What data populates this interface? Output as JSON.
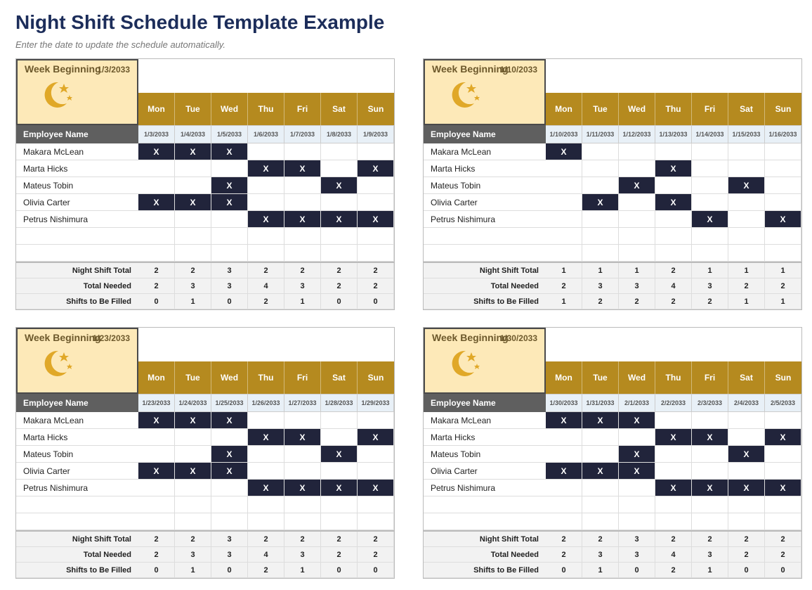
{
  "title": "Night Shift Schedule Template Example",
  "subtitle": "Enter the date to update the schedule automatically.",
  "labels": {
    "week_beginning": "Week Beginning",
    "employee_name": "Employee Name",
    "days": [
      "Mon",
      "Tue",
      "Wed",
      "Thu",
      "Fri",
      "Sat",
      "Sun"
    ],
    "totals": [
      "Night Shift Total",
      "Total Needed",
      "Shifts to Be Filled"
    ]
  },
  "employees": [
    "Makara McLean",
    "Marta Hicks",
    "Mateus Tobin",
    "Olivia Carter",
    "Petrus Nishimura"
  ],
  "blocks": [
    {
      "week_date": "1/3/2033",
      "dates": [
        "1/3/2033",
        "1/4/2033",
        "1/5/2033",
        "1/6/2033",
        "1/7/2033",
        "1/8/2033",
        "1/9/2033"
      ],
      "shifts": [
        [
          1,
          1,
          1,
          0,
          0,
          0,
          0
        ],
        [
          0,
          0,
          0,
          1,
          1,
          0,
          1
        ],
        [
          0,
          0,
          1,
          0,
          0,
          1,
          0
        ],
        [
          1,
          1,
          1,
          0,
          0,
          0,
          0
        ],
        [
          0,
          0,
          0,
          1,
          1,
          1,
          1
        ]
      ],
      "totals": [
        [
          2,
          2,
          3,
          2,
          2,
          2,
          2
        ],
        [
          2,
          3,
          3,
          4,
          3,
          2,
          2
        ],
        [
          0,
          1,
          0,
          2,
          1,
          0,
          0
        ]
      ]
    },
    {
      "week_date": "1/10/2033",
      "dates": [
        "1/10/2033",
        "1/11/2033",
        "1/12/2033",
        "1/13/2033",
        "1/14/2033",
        "1/15/2033",
        "1/16/2033"
      ],
      "shifts": [
        [
          1,
          0,
          0,
          0,
          0,
          0,
          0
        ],
        [
          0,
          0,
          0,
          1,
          0,
          0,
          0
        ],
        [
          0,
          0,
          1,
          0,
          0,
          1,
          0
        ],
        [
          0,
          1,
          0,
          1,
          0,
          0,
          0
        ],
        [
          0,
          0,
          0,
          0,
          1,
          0,
          1
        ]
      ],
      "totals": [
        [
          1,
          1,
          1,
          2,
          1,
          1,
          1
        ],
        [
          2,
          3,
          3,
          4,
          3,
          2,
          2
        ],
        [
          1,
          2,
          2,
          2,
          2,
          1,
          1
        ]
      ]
    },
    {
      "week_date": "1/23/2033",
      "dates": [
        "1/23/2033",
        "1/24/2033",
        "1/25/2033",
        "1/26/2033",
        "1/27/2033",
        "1/28/2033",
        "1/29/2033"
      ],
      "shifts": [
        [
          1,
          1,
          1,
          0,
          0,
          0,
          0
        ],
        [
          0,
          0,
          0,
          1,
          1,
          0,
          1
        ],
        [
          0,
          0,
          1,
          0,
          0,
          1,
          0
        ],
        [
          1,
          1,
          1,
          0,
          0,
          0,
          0
        ],
        [
          0,
          0,
          0,
          1,
          1,
          1,
          1
        ]
      ],
      "totals": [
        [
          2,
          2,
          3,
          2,
          2,
          2,
          2
        ],
        [
          2,
          3,
          3,
          4,
          3,
          2,
          2
        ],
        [
          0,
          1,
          0,
          2,
          1,
          0,
          0
        ]
      ]
    },
    {
      "week_date": "1/30/2033",
      "dates": [
        "1/30/2033",
        "1/31/2033",
        "2/1/2033",
        "2/2/2033",
        "2/3/2033",
        "2/4/2033",
        "2/5/2033"
      ],
      "shifts": [
        [
          1,
          1,
          1,
          0,
          0,
          0,
          0
        ],
        [
          0,
          0,
          0,
          1,
          1,
          0,
          1
        ],
        [
          0,
          0,
          1,
          0,
          0,
          1,
          0
        ],
        [
          1,
          1,
          1,
          0,
          0,
          0,
          0
        ],
        [
          0,
          0,
          0,
          1,
          1,
          1,
          1
        ]
      ],
      "totals": [
        [
          2,
          2,
          3,
          2,
          2,
          2,
          2
        ],
        [
          2,
          3,
          3,
          4,
          3,
          2,
          2
        ],
        [
          0,
          1,
          0,
          2,
          1,
          0,
          0
        ]
      ]
    }
  ]
}
